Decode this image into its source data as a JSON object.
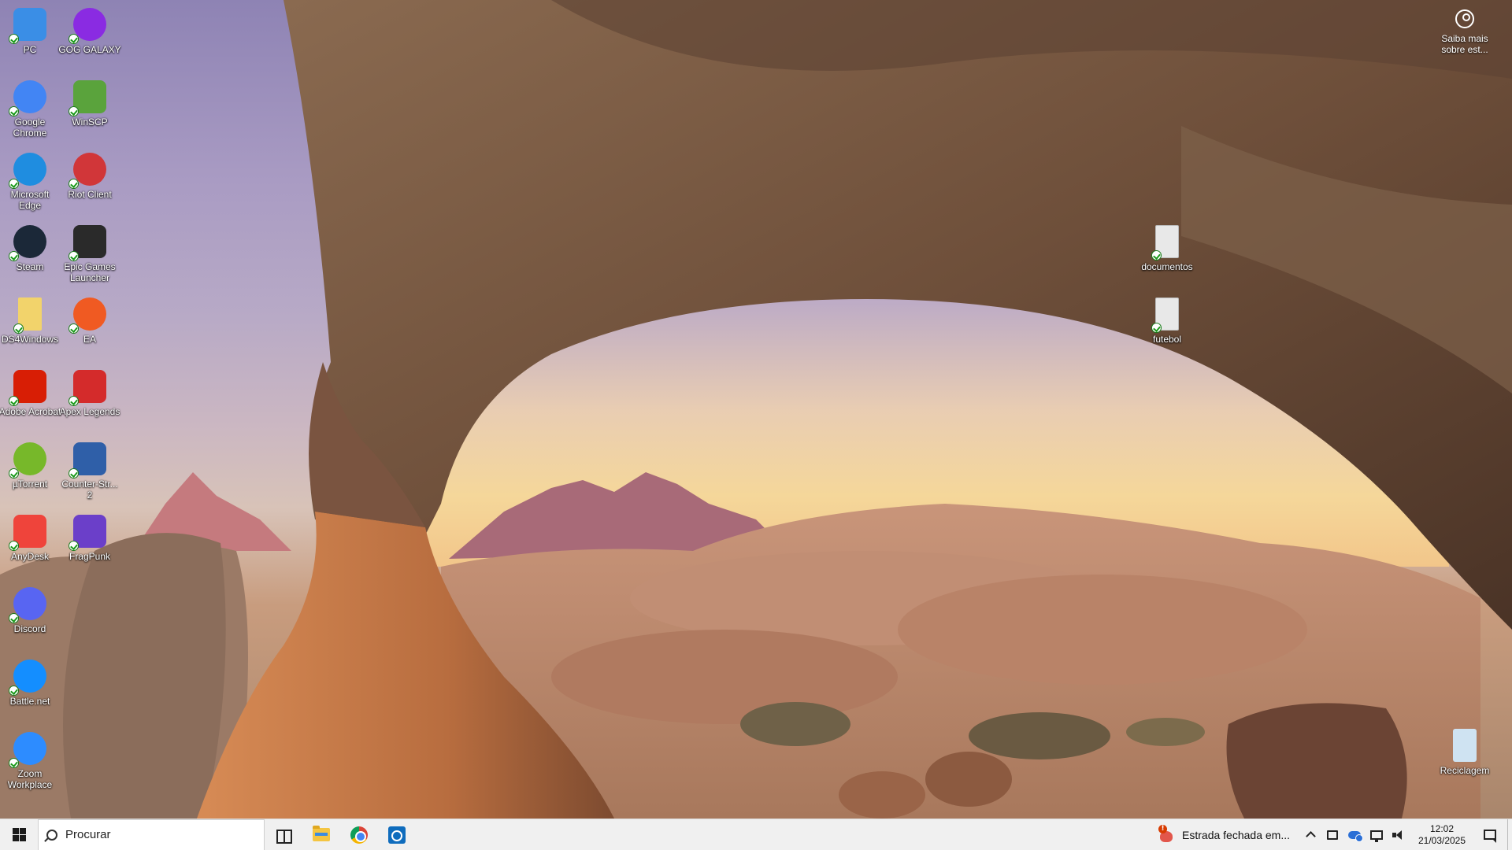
{
  "desktop": {
    "icons_left": [
      {
        "name": "pc",
        "label": "PC",
        "icon": "monitor-icon",
        "color": "#3a8ee6"
      },
      {
        "name": "gog-galaxy",
        "label": "GOG GALAXY",
        "icon": "gog-galaxy-icon",
        "color": "#8a2be2"
      },
      {
        "name": "google-chrome",
        "label": "Google Chrome",
        "icon": "chrome-icon",
        "color": "#4285f4"
      },
      {
        "name": "winscp",
        "label": "WinSCP",
        "icon": "winscp-icon",
        "color": "#5aa33c"
      },
      {
        "name": "microsoft-edge",
        "label": "Microsoft Edge",
        "icon": "edge-icon",
        "color": "#1f8de0"
      },
      {
        "name": "riot-client",
        "label": "Riot Client",
        "icon": "riot-client-icon",
        "color": "#d13639"
      },
      {
        "name": "steam",
        "label": "Steam",
        "icon": "steam-icon",
        "color": "#1b2838"
      },
      {
        "name": "epic-games-launcher",
        "label": "Epic Games Launcher",
        "icon": "epic-games-icon",
        "color": "#2a2a2a"
      },
      {
        "name": "ds4windows",
        "label": "DS4Windows",
        "icon": "folder-icon",
        "color": "#f2d36b"
      },
      {
        "name": "ea",
        "label": "EA",
        "icon": "ea-icon",
        "color": "#f05a22"
      },
      {
        "name": "adobe-acrobat",
        "label": "Adobe Acrobat",
        "icon": "acrobat-icon",
        "color": "#d81e05"
      },
      {
        "name": "apex-legends",
        "label": "Apex Legends",
        "icon": "apex-icon",
        "color": "#d42b2b"
      },
      {
        "name": "utorrent",
        "label": "µTorrent",
        "icon": "utorrent-icon",
        "color": "#77b82a"
      },
      {
        "name": "counter-strike-2",
        "label": "Counter-Str... 2",
        "icon": "counter-strike-icon",
        "color": "#2f5fa8"
      },
      {
        "name": "anydesk",
        "label": "AnyDesk",
        "icon": "anydesk-icon",
        "color": "#ef443b"
      },
      {
        "name": "fragpunk",
        "label": "FragPunk",
        "icon": "fragpunk-icon",
        "color": "#6b3fc9"
      },
      {
        "name": "discord",
        "label": "Discord",
        "icon": "discord-icon",
        "color": "#5865f2"
      },
      {
        "name": "battle-net",
        "label": "Battle.net",
        "icon": "battlenet-icon",
        "color": "#148eff"
      },
      {
        "name": "zoom-workplace",
        "label": "Zoom Workplace",
        "icon": "zoom-icon",
        "color": "#2d8cff"
      }
    ],
    "icons_right": [
      {
        "name": "documentos",
        "label": "documentos",
        "icon": "pdf-icon",
        "color": "#e8e8e8"
      },
      {
        "name": "futebol",
        "label": "futebol",
        "icon": "pdf-icon",
        "color": "#e8e8e8"
      },
      {
        "name": "reciclagem",
        "label": "Reciclagem",
        "icon": "recycle-bin-icon",
        "color": "#cfe3f2"
      }
    ],
    "info_label": "Saiba mais sobre est..."
  },
  "taskbar": {
    "search_placeholder": "Procurar",
    "apps": [
      "task-view-icon",
      "file-explorer-icon",
      "chrome-icon",
      "outlook-icon"
    ],
    "news_text": "Estrada fechada em...",
    "time": "12:02",
    "date": "21/03/2025"
  }
}
